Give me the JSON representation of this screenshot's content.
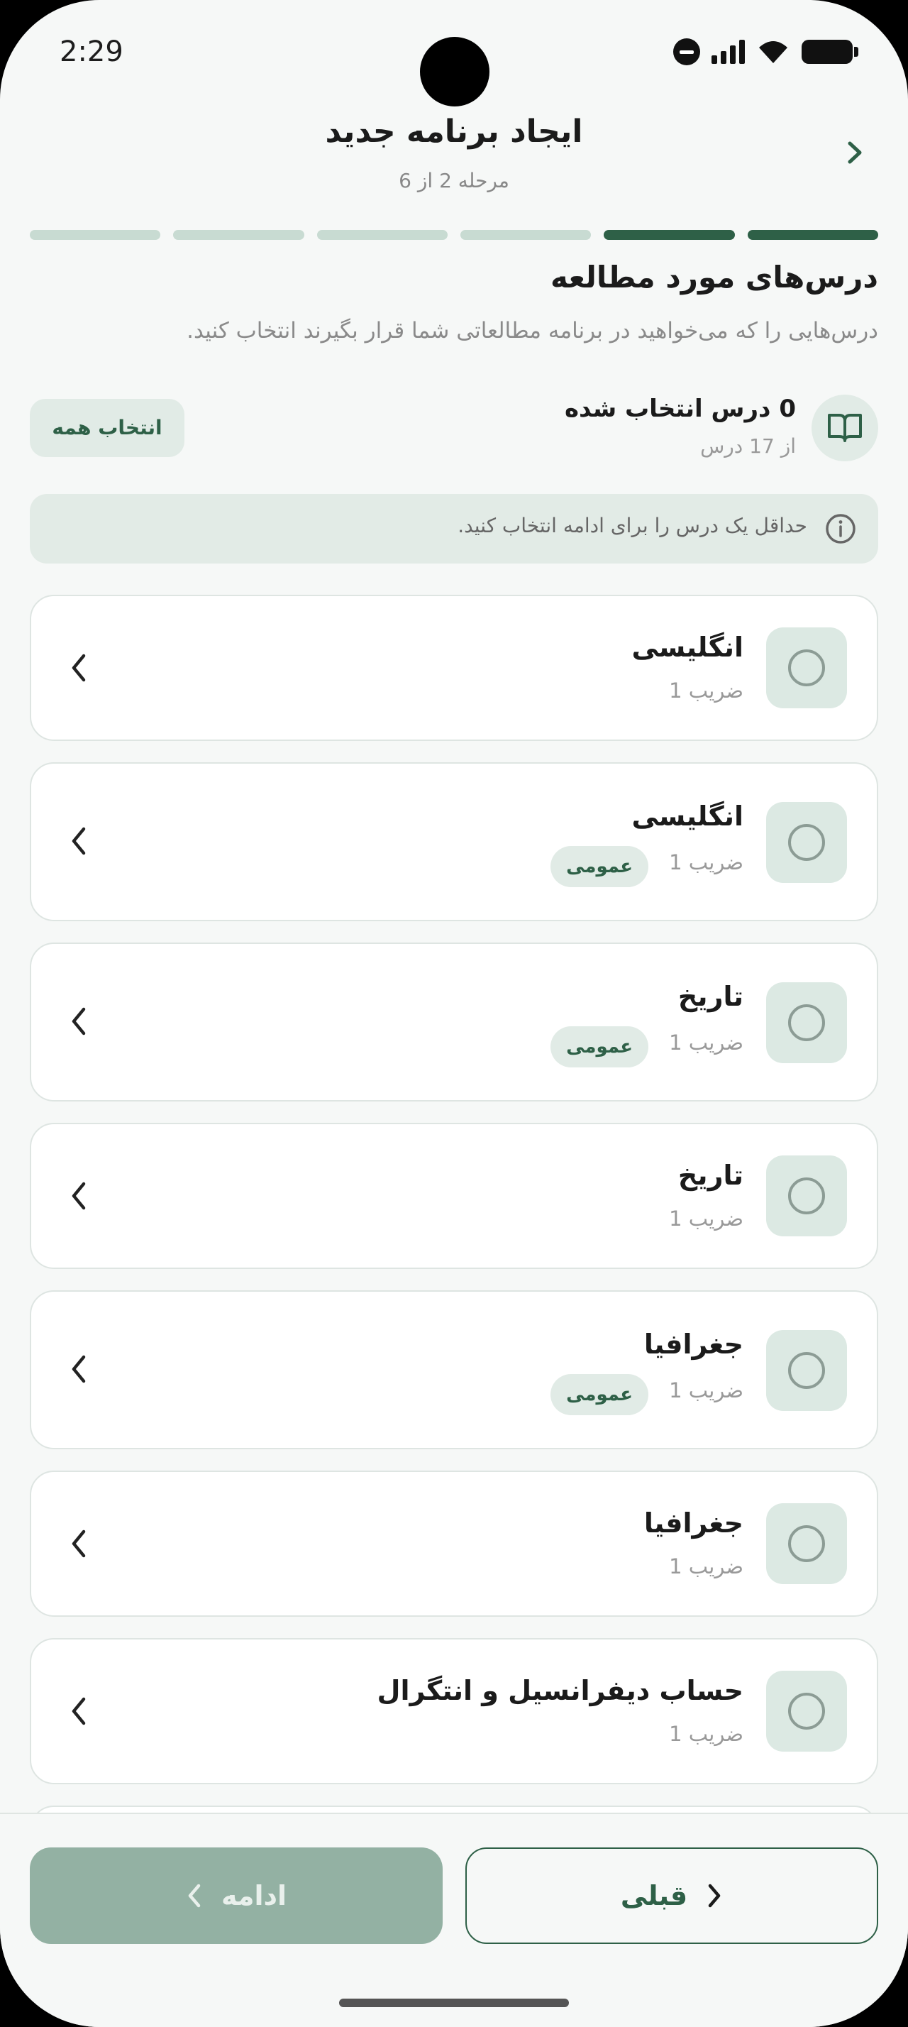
{
  "status_bar": {
    "time": "2:29"
  },
  "header": {
    "title": "ایجاد برنامه جدید",
    "step": "مرحله 2 از 6"
  },
  "progress": {
    "total_steps": 6,
    "current_step": 2
  },
  "section": {
    "title": "درس‌های مورد مطالعه",
    "description": "درس‌هایی را که می‌خواهید در برنامه مطالعاتی شما قرار بگیرند انتخاب کنید."
  },
  "selection": {
    "count_label": "0 درس انتخاب شده",
    "total_label": "از 17 درس",
    "select_all": "انتخاب همه"
  },
  "notice": {
    "text": "حداقل یک درس را برای ادامه انتخاب کنید."
  },
  "courses": [
    {
      "name": "انگلیسی",
      "coef": "ضریب 1",
      "badge": ""
    },
    {
      "name": "انگلیسی",
      "coef": "ضریب 1",
      "badge": "عمومی"
    },
    {
      "name": "تاریخ",
      "coef": "ضریب 1",
      "badge": "عمومی"
    },
    {
      "name": "تاریخ",
      "coef": "ضریب 1",
      "badge": ""
    },
    {
      "name": "جغرافیا",
      "coef": "ضریب 1",
      "badge": "عمومی"
    },
    {
      "name": "جغرافیا",
      "coef": "ضریب 1",
      "badge": ""
    },
    {
      "name": "حساب دیفرانسیل و انتگرال",
      "coef": "ضریب 1",
      "badge": ""
    }
  ],
  "footer": {
    "next": "ادامه",
    "prev": "قبلی"
  },
  "colors": {
    "primary": "#2e6047",
    "light": "#e1ebe6",
    "disabled": "#93b1a3"
  },
  "icons": {
    "back": "chevron-right-icon",
    "book": "book-open-icon",
    "info": "info-icon",
    "expand": "chevron-left-icon"
  }
}
